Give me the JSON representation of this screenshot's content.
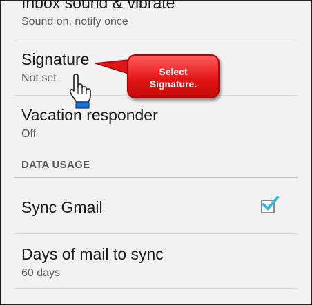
{
  "settings": {
    "inbox_sound": {
      "title": "Inbox sound & vibrate",
      "subtitle": "Sound on, notify once"
    },
    "signature": {
      "title": "Signature",
      "subtitle": "Not set"
    },
    "vacation": {
      "title": "Vacation responder",
      "subtitle": "Off"
    },
    "section_header": "DATA USAGE",
    "sync_gmail": {
      "title": "Sync Gmail",
      "checked": true
    },
    "days_to_sync": {
      "title": "Days of mail to sync",
      "subtitle": "60 days"
    }
  },
  "callout": {
    "line1": "Select",
    "line2": "Signature."
  },
  "colors": {
    "callout_red": "#e01414",
    "checkmark_blue": "#33b5e5",
    "cursor_blue": "#1a6fd8"
  },
  "icons": {
    "checkbox": "checkmark-icon",
    "pointer": "hand-pointer-icon"
  }
}
